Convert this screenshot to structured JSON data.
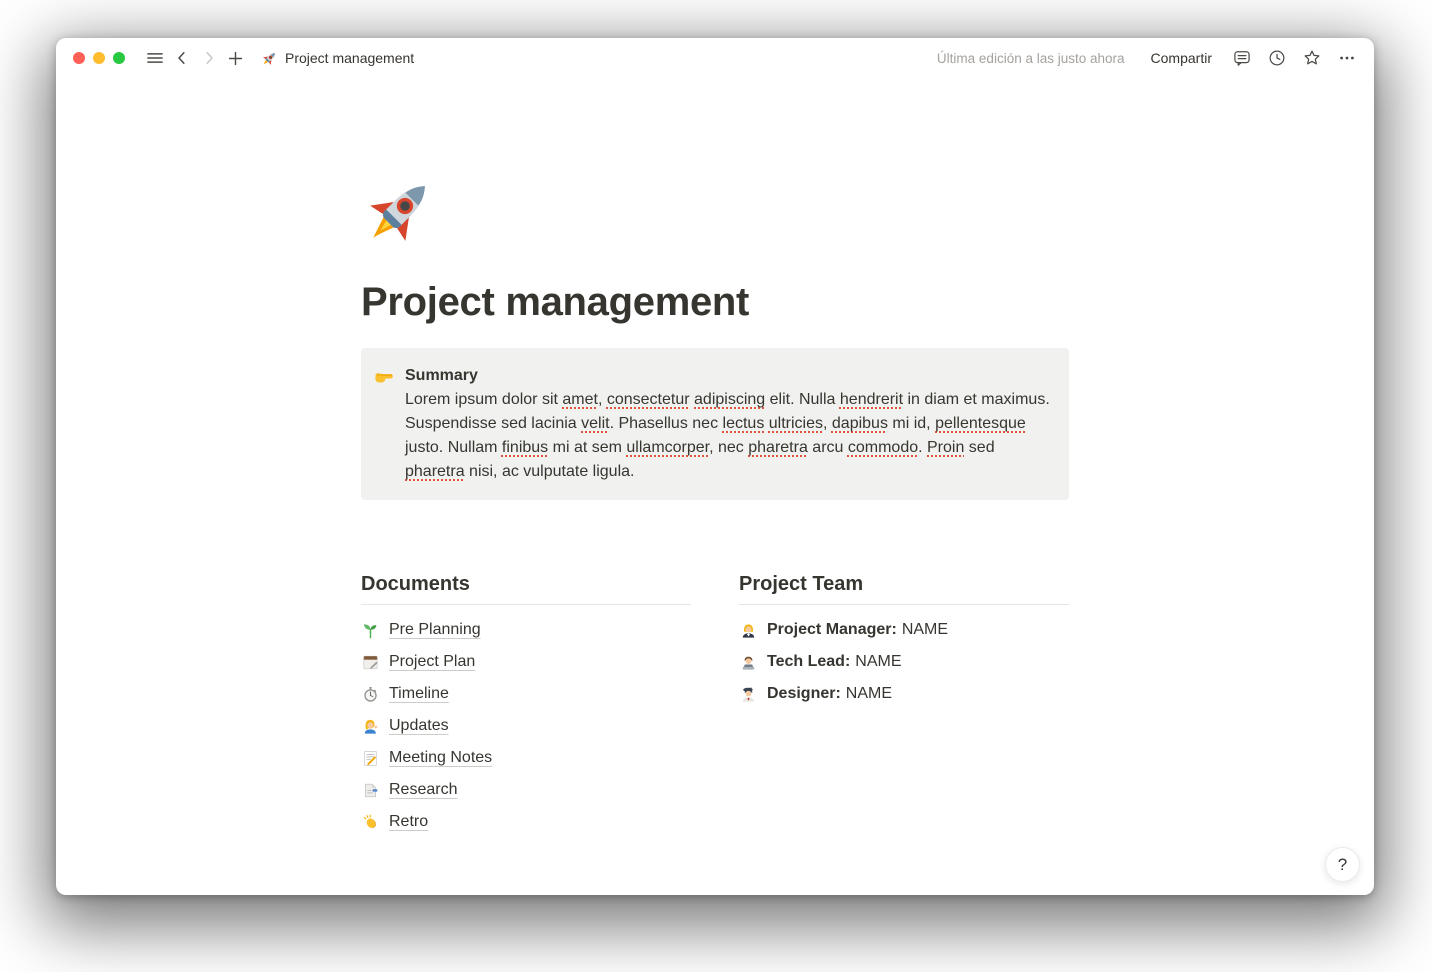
{
  "titlebar": {
    "page_icon": "rocket-emoji",
    "page_title": "Project management",
    "last_edited": "Última edición a las justo ahora",
    "share_label": "Compartir"
  },
  "page": {
    "icon": "rocket-emoji",
    "title": "Project management",
    "callout": {
      "icon": "pointing-right-emoji",
      "heading": "Summary",
      "body": "Lorem ipsum dolor sit amet, consectetur adipiscing elit. Nulla hendrerit in diam et maximus. Suspendisse sed lacinia velit. Phasellus nec lectus ultricies, dapibus mi id, pellentesque justo. Nullam finibus mi at sem ullamcorper, nec pharetra arcu commodo. Proin sed pharetra nisi, ac vulputate ligula.",
      "misspelled_words": [
        "amet",
        "consectetur",
        "adipiscing",
        "hendrerit",
        "velit",
        "lectus",
        "ultricies",
        "dapibus",
        "pellentesque",
        "finibus",
        "ullamcorper",
        "pharetra",
        "commodo",
        "Proin"
      ]
    },
    "documents": {
      "heading": "Documents",
      "items": [
        {
          "icon": "seedling-emoji",
          "label": "Pre Planning"
        },
        {
          "icon": "notepad-emoji",
          "label": "Project Plan"
        },
        {
          "icon": "stopwatch-emoji",
          "label": "Timeline"
        },
        {
          "icon": "woman-tipping-hand-emoji",
          "label": "Updates"
        },
        {
          "icon": "memo-emoji",
          "label": "Meeting Notes"
        },
        {
          "icon": "bookmark-tabs-emoji",
          "label": "Research"
        },
        {
          "icon": "clapping-hands-emoji",
          "label": "Retro"
        }
      ]
    },
    "team": {
      "heading": "Project Team",
      "items": [
        {
          "icon": "woman-office-worker-emoji",
          "role": "Project Manager:",
          "name": "NAME"
        },
        {
          "icon": "man-technologist-emoji",
          "role": "Tech Lead:",
          "name": "NAME"
        },
        {
          "icon": "man-artist-emoji",
          "role": "Designer:",
          "name": "NAME"
        }
      ]
    }
  },
  "help_button_label": "?",
  "colors": {
    "text": "#37352F",
    "muted_text": "#A5A29E",
    "callout_bg": "#F1F1EF",
    "divider": "#E7E6E3",
    "spellcheck": "#E0533D",
    "traffic_close": "#FF5F57",
    "traffic_minimize": "#FEBC2E",
    "traffic_zoom": "#28C840"
  }
}
